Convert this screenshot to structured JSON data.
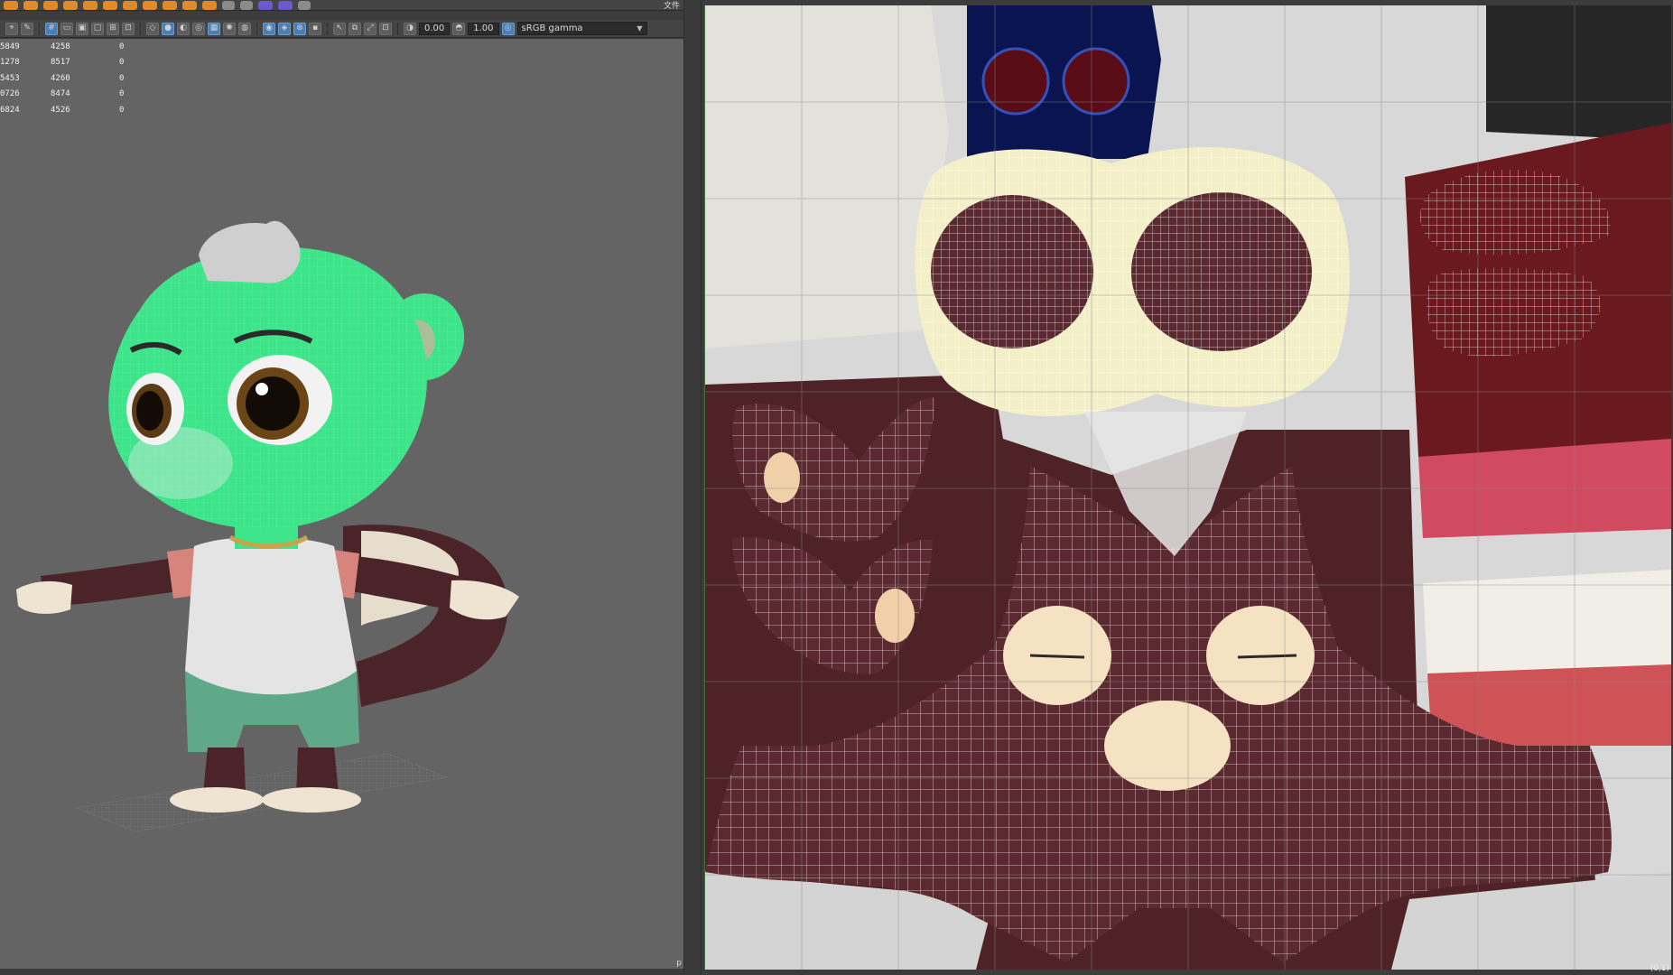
{
  "shelf": {
    "label": "文件"
  },
  "viewport_toolbar": {
    "exposure_value": "0.00",
    "gamma_value": "1.00",
    "color_space": "sRGB gamma"
  },
  "poly_stats": [
    [
      "5849",
      "4258",
      "0"
    ],
    [
      "1278",
      "8517",
      "0"
    ],
    [
      "5453",
      "4260",
      "0"
    ],
    [
      "0726",
      "8474",
      "0"
    ],
    [
      "6824",
      "4526",
      "0"
    ]
  ],
  "uv_editor": {
    "corner_readout": "(0,1)"
  },
  "viewport": {
    "corner_label": "p"
  },
  "colors": {
    "viewport_bg": "#646464",
    "wireframe_highlight": "#3ee48a",
    "fur_dark": "#5a2a2e",
    "uv_grid_bg": "#d6d6d6",
    "accent_blue": "#4a7fb6"
  },
  "icons": {
    "shelf": [
      "sphere-icon",
      "cube-icon",
      "cylinder-icon",
      "cone-icon",
      "plane-icon",
      "torus-icon",
      "pipe-icon",
      "helix-icon",
      "gear-icon",
      "soccer-icon",
      "text-icon",
      "svg-icon",
      "camera-icon",
      "light-icon",
      "ik-icon",
      "curve-icon"
    ],
    "toolbar": [
      "select-camera-icon",
      "camera-attr-icon",
      "bookmark-icon",
      "image-plane-icon",
      "grid-icon",
      "film-gate-icon",
      "resolution-gate-icon",
      "gate-mask-icon",
      "field-chart-icon",
      "safe-action-icon",
      "wireframe-icon",
      "smooth-shade-icon",
      "textured-icon",
      "lights-icon",
      "shadows-icon",
      "ambient-occlusion-icon",
      "motion-blur-icon",
      "isolate-select-icon",
      "xray-icon",
      "xray-joints-icon",
      "exposure-icon",
      "gamma-icon",
      "color-management-icon"
    ]
  }
}
